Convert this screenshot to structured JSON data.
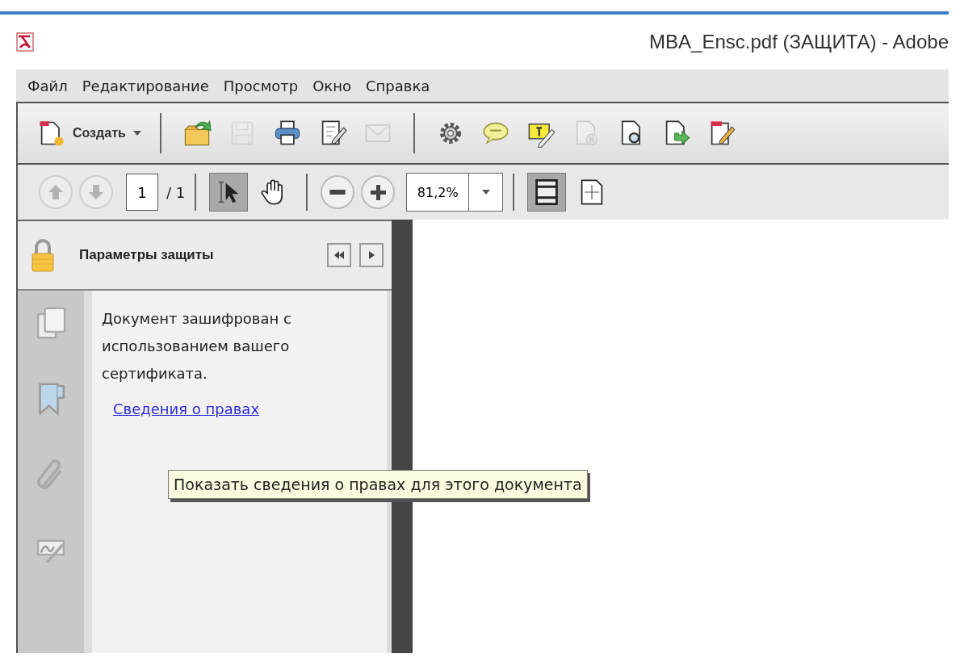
{
  "window": {
    "title": "MBA_Ensc.pdf (ЗАЩИТА) - Adobe"
  },
  "menu": [
    "Файл",
    "Редактирование",
    "Просмотр",
    "Окно",
    "Справка"
  ],
  "toolbar": {
    "create_label": "Создать",
    "groups": [
      [
        {
          "kind": "open",
          "disabled": false
        },
        {
          "kind": "save",
          "disabled": true
        },
        {
          "kind": "print",
          "disabled": false
        },
        {
          "kind": "edit",
          "disabled": false
        },
        {
          "kind": "mail",
          "disabled": true
        }
      ],
      [
        {
          "kind": "gear",
          "disabled": false
        },
        {
          "kind": "comment",
          "disabled": false
        },
        {
          "kind": "highlight",
          "disabled": false
        },
        {
          "kind": "page-remove",
          "disabled": true
        },
        {
          "kind": "page-search",
          "disabled": false
        },
        {
          "kind": "page-arrow",
          "disabled": false
        },
        {
          "kind": "page-sign",
          "disabled": false
        }
      ]
    ]
  },
  "navigation": {
    "page": "1",
    "total": "/ 1",
    "prev_disabled": true,
    "next_disabled": true
  },
  "tools": [
    {
      "kind": "select",
      "selected": true
    },
    {
      "kind": "hand",
      "selected": false
    }
  ],
  "zoom": {
    "value": "81,2%"
  },
  "views": [
    {
      "kind": "fit-page",
      "selected": true
    },
    {
      "kind": "fit-width",
      "selected": false
    }
  ],
  "panel": {
    "title": "Параметры защиты",
    "message": "Документ зашифрован с использованием вашего сертификата.",
    "link": "Сведения о правах",
    "side_icons": [
      {
        "kind": "pages"
      },
      {
        "kind": "bookmark"
      },
      {
        "kind": "attachment"
      },
      {
        "kind": "signature"
      }
    ]
  },
  "tooltip": "Показать сведения о правах для этого документа"
}
